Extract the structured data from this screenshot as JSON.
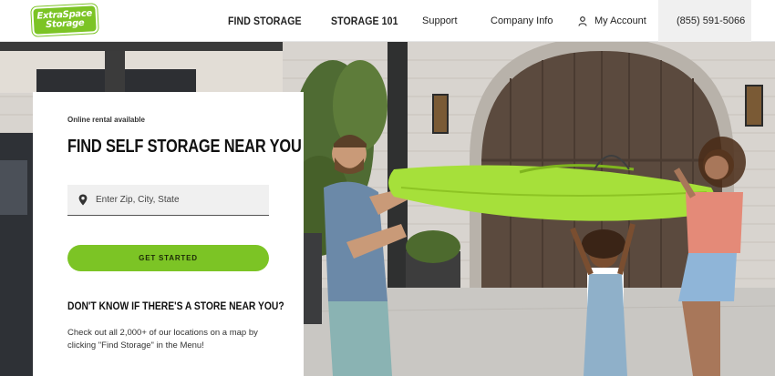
{
  "brand": {
    "logo_line1": "ExtraSpace",
    "logo_line2": "Storage",
    "brand_color": "#7cc425"
  },
  "nav": {
    "find_storage": "FIND STORAGE",
    "storage_101": "STORAGE 101",
    "support": "Support",
    "company_info": "Company Info",
    "my_account": "My Account",
    "phone": "(855) 591-5066"
  },
  "card": {
    "eyebrow": "Online rental available",
    "title": "FIND SELF STORAGE NEAR YOU",
    "search_placeholder": "Enter Zip, City, State",
    "search_value": "",
    "cta": "GET STARTED",
    "subtitle": "DON'T KNOW IF THERE'S A STORE NEAR YOU?",
    "body": "Check out all 2,000+ of our locations on a map by clicking \"Find Storage\" in the Menu!"
  },
  "icons": {
    "account": "person-icon",
    "phone": "phone-icon",
    "search": "map-pin-icon"
  }
}
